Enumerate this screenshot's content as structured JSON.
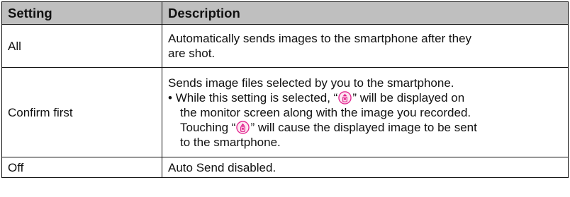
{
  "table": {
    "headers": [
      "Setting",
      "Description"
    ],
    "rows": [
      {
        "setting": "All",
        "description_lines": [
          "Automatically sends images to the smartphone after they",
          "are shot."
        ]
      },
      {
        "setting": "Confirm first",
        "description_intro": "Sends image files selected by you to the smartphone.",
        "bullet": "•",
        "bullet_line1_before": "While this setting is selected, “",
        "bullet_line1_after": "” will be displayed on",
        "bullet_line2": "the monitor screen along with the image you recorded.",
        "bullet_line3_before": "Touching “",
        "bullet_line3_after": "” will cause the displayed image to be sent",
        "bullet_line4": "to the smartphone."
      },
      {
        "setting": "Off",
        "description": "Auto Send disabled."
      }
    ]
  },
  "icons": {
    "send_icon": "smartphone-send-icon"
  },
  "colors": {
    "header_bg": "#bfbfbf",
    "icon_color": "#e2238f"
  }
}
